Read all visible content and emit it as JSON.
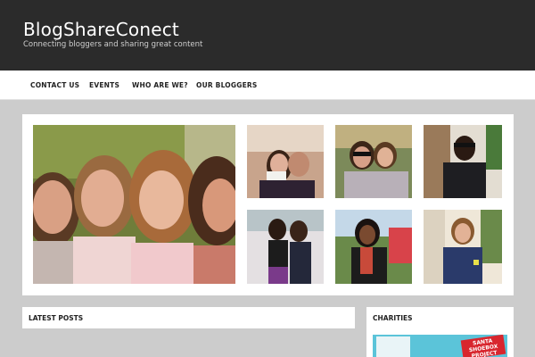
{
  "site": {
    "title": "BlogShareConect",
    "description": "Connecting bloggers and sharing great content"
  },
  "nav": {
    "items": [
      {
        "label": "CONTACT US"
      },
      {
        "label": "EVENTS"
      },
      {
        "label": "WHO ARE WE?"
      },
      {
        "label": "OUR BLOGGERS"
      }
    ]
  },
  "gallery": {
    "photos": [
      {
        "name": "group-selfie-photo"
      },
      {
        "name": "blogger-photo-1"
      },
      {
        "name": "blogger-photo-2"
      },
      {
        "name": "blogger-photo-3"
      },
      {
        "name": "blogger-photo-4"
      },
      {
        "name": "blogger-photo-5"
      },
      {
        "name": "blogger-photo-6"
      }
    ]
  },
  "widgets": {
    "latest_posts_title": "LATEST POSTS",
    "charities_title": "CHARITIES",
    "charity_banner_text": "SANTA SHOEBOX PROJECT"
  },
  "colors": {
    "header_bg": "#2b2b2b",
    "page_bg": "#cccccc",
    "charity_banner": "#5bc4d9",
    "santa_red": "#d8262e"
  }
}
